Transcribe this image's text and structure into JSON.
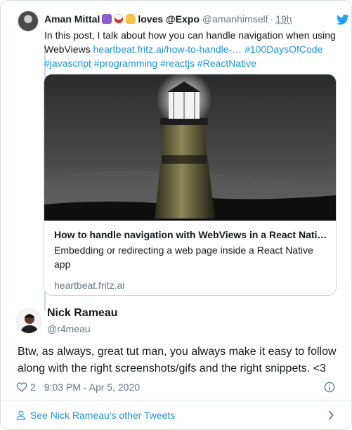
{
  "parent_tweet": {
    "name": "Aman Mittal",
    "emoji_icons": [
      "atom-icon",
      "coffee-cup-icon",
      "vulcan-hand-icon"
    ],
    "name_suffix": "loves @Expo",
    "handle": "@amanhimself",
    "separator": "·",
    "time": "19h",
    "text_line1": "In this post, I talk about how you can handle navigation when using",
    "text_line2_plain": "WebViews ",
    "link_url": "heartbeat.fritz.ai/how-to-handle-…",
    "hashtag_line2": "#100DaysOfCode",
    "hashtags_line3": "#javascript #programming #reactjs #ReactNative"
  },
  "link_card": {
    "image": "lighthouse-photo",
    "title": "How to handle navigation with WebViews in a React Nati…",
    "description": "Embedding or redirecting a web page inside a React Native app",
    "domain": "heartbeat.fritz.ai"
  },
  "tweet": {
    "author_name": "Nick Rameau",
    "author_handle": "@r4meau",
    "text": "Btw, as always, great tut man, you always make it easy to follow along with the right screenshots/gifs and the right snippets. <3",
    "like_count": "2",
    "timestamp": "9:03 PM - Apr 5, 2020"
  },
  "footer": {
    "label": "See Nick Rameau's other Tweets"
  },
  "colors": {
    "link": "#1b95e0",
    "secondary_text": "#657786",
    "border": "#e1e8ed",
    "twitter_blue": "#1da1f2"
  }
}
